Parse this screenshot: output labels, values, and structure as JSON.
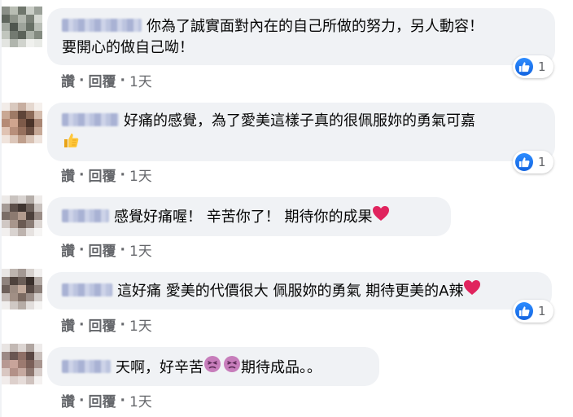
{
  "comments": [
    {
      "lines": [
        "你為了誠實面對內在的自己所做的努力，另人動容！",
        "要開心的做自己呦！"
      ],
      "suffix_emoji": "",
      "reaction": {
        "icon": "thumbs-up-icon",
        "count": "1"
      },
      "actions": {
        "like": "讚",
        "reply": "回覆",
        "time": "1天"
      }
    },
    {
      "lines": [
        "好痛的感覺，為了愛美這樣子真的很佩服妳的勇氣可嘉"
      ],
      "suffix_emoji": "thumbs-up-emoji",
      "reaction": {
        "icon": "thumbs-up-icon",
        "count": "1"
      },
      "actions": {
        "like": "讚",
        "reply": "回覆",
        "time": "1天"
      }
    },
    {
      "lines": [
        "感覺好痛喔！ 辛苦你了！ 期待你的成果"
      ],
      "suffix_emoji": "red-heart-emoji",
      "reaction": null,
      "actions": {
        "like": "讚",
        "reply": "回覆",
        "time": "1天"
      }
    },
    {
      "lines": [
        "這好痛 愛美的代價很大 佩服妳的勇氣 期待更美的A辣"
      ],
      "suffix_emoji": "red-heart-emoji",
      "reaction": {
        "icon": "thumbs-up-icon",
        "count": "1"
      },
      "actions": {
        "like": "讚",
        "reply": "回覆",
        "time": "1天"
      }
    },
    {
      "lines": [
        "天啊，好辛苦",
        "期待成品。。"
      ],
      "suffix_emoji": "persevering-face-emoji",
      "reaction": null,
      "actions": {
        "like": "讚",
        "reply": "回覆",
        "time": "1天"
      }
    }
  ],
  "colors": {
    "bubble": "#f0f2f5",
    "meta_text": "#65676b",
    "like_blue": "#1877f2",
    "heart_red": "#e0245e"
  }
}
